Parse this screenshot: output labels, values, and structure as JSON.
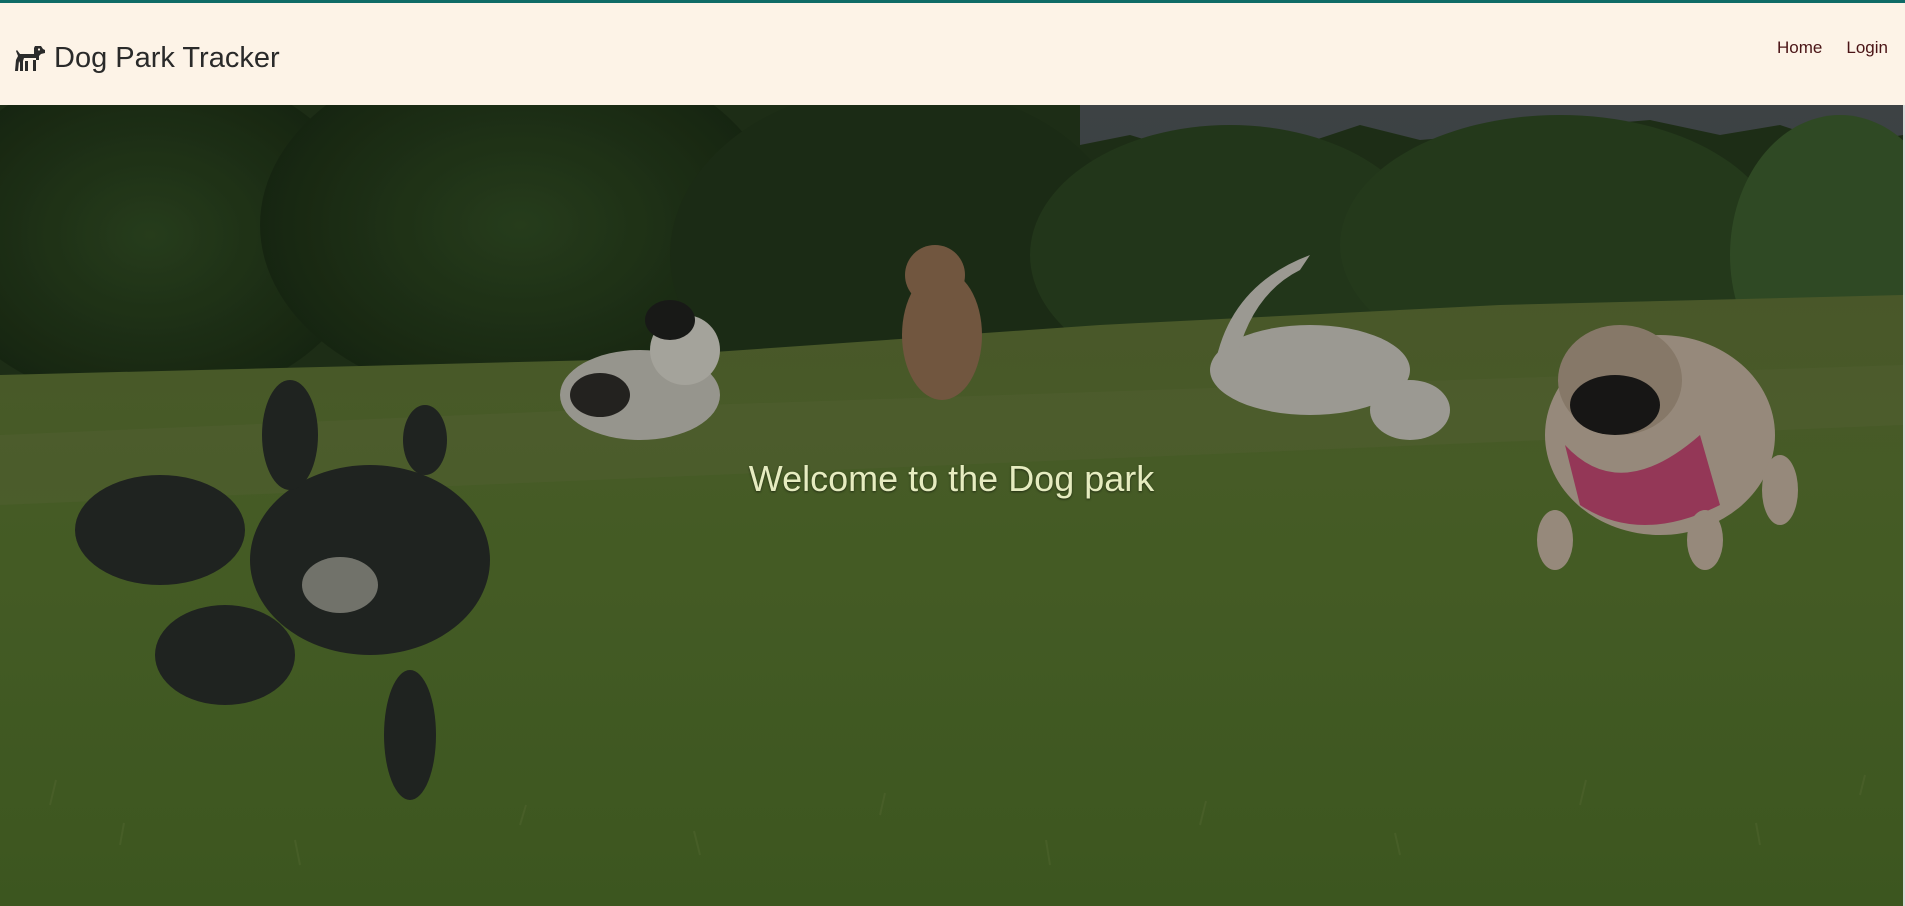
{
  "header": {
    "brand_icon": "dog-icon",
    "brand_title": "Dog Park Tracker",
    "nav": [
      {
        "label": "Home"
      },
      {
        "label": "Login"
      }
    ],
    "accent_color": "#0f6b67",
    "background_color": "#fdf3e7"
  },
  "hero": {
    "title": "Welcome to the Dog park",
    "image_description_name": "dogs-running-in-park-image",
    "title_color": "#e6ecc0"
  }
}
